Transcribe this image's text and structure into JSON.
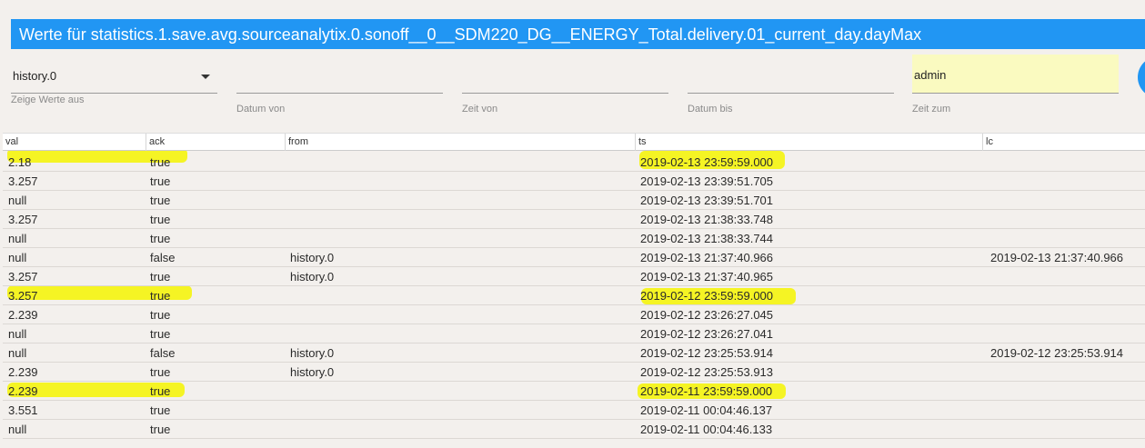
{
  "dialog": {
    "title": "Werte für statistics.1.save.avg.sourceanalytix.0.sonoff__0__SDM220_DG__ENERGY_Total.delivery.01_current_day.dayMax"
  },
  "filters": {
    "instance": {
      "value": "history.0",
      "caption": "Zeige Werte aus"
    },
    "date_from": {
      "value": "",
      "caption": "Datum von"
    },
    "time_from": {
      "value": "",
      "caption": "Zeit von"
    },
    "date_to": {
      "value": "",
      "caption": "Datum bis"
    },
    "time_to": {
      "value": "admin",
      "caption": "Zeit zum"
    }
  },
  "table": {
    "columns": [
      "val",
      "ack",
      "from",
      "ts",
      "lc"
    ],
    "rows": [
      [
        "2.18",
        "true",
        "",
        "2019-02-13 23:59:59.000",
        ""
      ],
      [
        "3.257",
        "true",
        "",
        "2019-02-13 23:39:51.705",
        ""
      ],
      [
        "null",
        "true",
        "",
        "2019-02-13 23:39:51.701",
        ""
      ],
      [
        "3.257",
        "true",
        "",
        "2019-02-13 21:38:33.748",
        ""
      ],
      [
        "null",
        "true",
        "",
        "2019-02-13 21:38:33.744",
        ""
      ],
      [
        "null",
        "false",
        "history.0",
        "2019-02-13 21:37:40.966",
        "2019-02-13 21:37:40.966"
      ],
      [
        "3.257",
        "true",
        "history.0",
        "2019-02-13 21:37:40.965",
        ""
      ],
      [
        "3.257",
        "true",
        "",
        "2019-02-12 23:59:59.000",
        ""
      ],
      [
        "2.239",
        "true",
        "",
        "2019-02-12 23:26:27.045",
        ""
      ],
      [
        "null",
        "true",
        "",
        "2019-02-12 23:26:27.041",
        ""
      ],
      [
        "null",
        "false",
        "history.0",
        "2019-02-12 23:25:53.914",
        "2019-02-12 23:25:53.914"
      ],
      [
        "2.239",
        "true",
        "history.0",
        "2019-02-12 23:25:53.913",
        ""
      ],
      [
        "2.239",
        "true",
        "",
        "2019-02-11 23:59:59.000",
        ""
      ],
      [
        "3.551",
        "true",
        "",
        "2019-02-11 00:04:46.137",
        ""
      ],
      [
        "null",
        "true",
        "",
        "2019-02-11 00:04:46.133",
        ""
      ]
    ]
  },
  "colors": {
    "accent": "#2196f3",
    "highlight": "#f4f400",
    "background": "#f3f0ed"
  }
}
